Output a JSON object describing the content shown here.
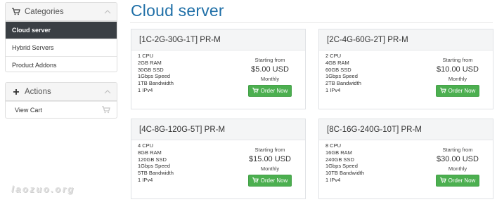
{
  "sidebar": {
    "categories": {
      "title": "Categories",
      "items": [
        {
          "label": "Cloud server",
          "active": true
        },
        {
          "label": "Hybrid Servers",
          "active": false
        },
        {
          "label": "Product Addons",
          "active": false
        }
      ]
    },
    "actions": {
      "title": "Actions",
      "items": [
        {
          "label": "View Cart"
        }
      ]
    }
  },
  "page": {
    "title": "Cloud server"
  },
  "products": [
    {
      "name": "[1C-2G-30G-1T] PR-M",
      "features": [
        "1 CPU",
        "2GB RAM",
        "30GB SSD",
        "1Gbps Speed",
        "1TB Bandwidth",
        "1 IPv4"
      ],
      "starting_label": "Starting from",
      "price": "$5.00 USD",
      "cycle": "Monthly",
      "button_label": "Order Now"
    },
    {
      "name": "[2C-4G-60G-2T] PR-M",
      "features": [
        "2 CPU",
        "4GB RAM",
        "60GB SSD",
        "1Gbps Speed",
        "2TB Bandwidth",
        "1 IPv4"
      ],
      "starting_label": "Starting from",
      "price": "$10.00 USD",
      "cycle": "Monthly",
      "button_label": "Order Now"
    },
    {
      "name": "[4C-8G-120G-5T] PR-M",
      "features": [
        "4 CPU",
        "8GB RAM",
        "120GB SSD",
        "1Gbps Speed",
        "5TB Bandwidth",
        "1 IPv4"
      ],
      "starting_label": "Starting from",
      "price": "$15.00 USD",
      "cycle": "Monthly",
      "button_label": "Order Now"
    },
    {
      "name": "[8C-16G-240G-10T] PR-M",
      "features": [
        "8 CPU",
        "16GB RAM",
        "240GB SSD",
        "1Gbps Speed",
        "10TB Bandwidth",
        "1 IPv4"
      ],
      "starting_label": "Starting from",
      "price": "$30.00 USD",
      "cycle": "Monthly",
      "button_label": "Order Now"
    }
  ],
  "watermark": "laozuo.org",
  "colors": {
    "accent": "#1f6fa7",
    "active_nav_bg": "#3a3f44",
    "order_button": "#4caf50"
  }
}
